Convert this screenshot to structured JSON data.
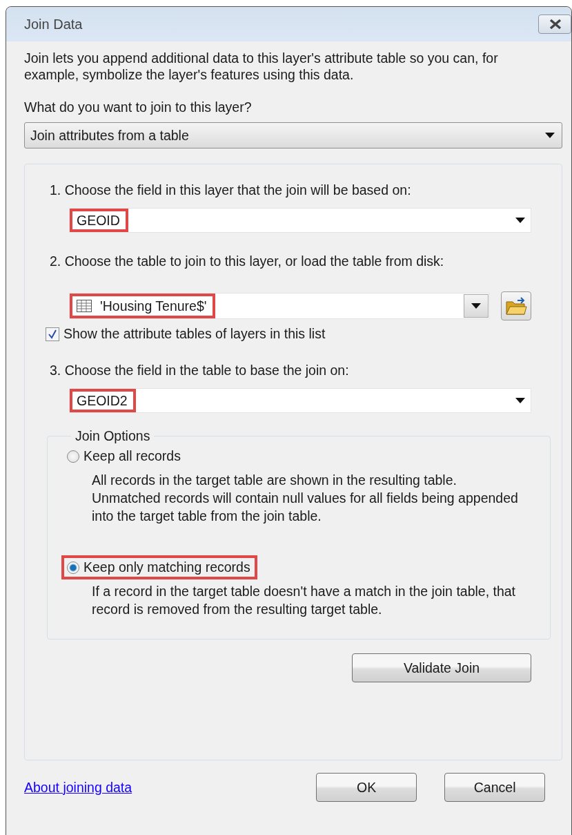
{
  "window": {
    "title": "Join Data"
  },
  "intro": "Join lets you append additional data to this layer's attribute table so you can, for example, symbolize the layer's features using this data.",
  "join_type": {
    "label": "What do you want to join to this layer?",
    "value": "Join attributes from a table"
  },
  "steps": [
    {
      "kind": "dropdown",
      "label": "1.  Choose the field in this layer that the join will be based on:",
      "value": "GEOID",
      "highlighted": true
    },
    {
      "kind": "table_picker",
      "label": "2.  Choose the table to join to this layer, or load the table from disk:",
      "value": "'Housing Tenure$'",
      "highlighted": true,
      "checkbox": {
        "label": "Show the attribute tables of layers in this list",
        "checked": true
      }
    },
    {
      "kind": "dropdown",
      "label": "3.  Choose the field in the table to base the join on:",
      "value": "GEOID2",
      "highlighted": true
    }
  ],
  "join_options": {
    "title": "Join Options",
    "options": [
      {
        "label": "Keep all records",
        "selected": false,
        "highlighted": false,
        "description": "All records in the target table are shown in the resulting table. Unmatched records will contain null values for all fields being appended into the target table from the join table."
      },
      {
        "label": "Keep only matching records",
        "selected": true,
        "highlighted": true,
        "description": "If a record in the target table doesn't have a match in the join table, that record is removed from the resulting target table."
      }
    ]
  },
  "validate_button": "Validate Join",
  "help_link": "About joining data",
  "buttons": [
    "OK",
    "Cancel"
  ]
}
